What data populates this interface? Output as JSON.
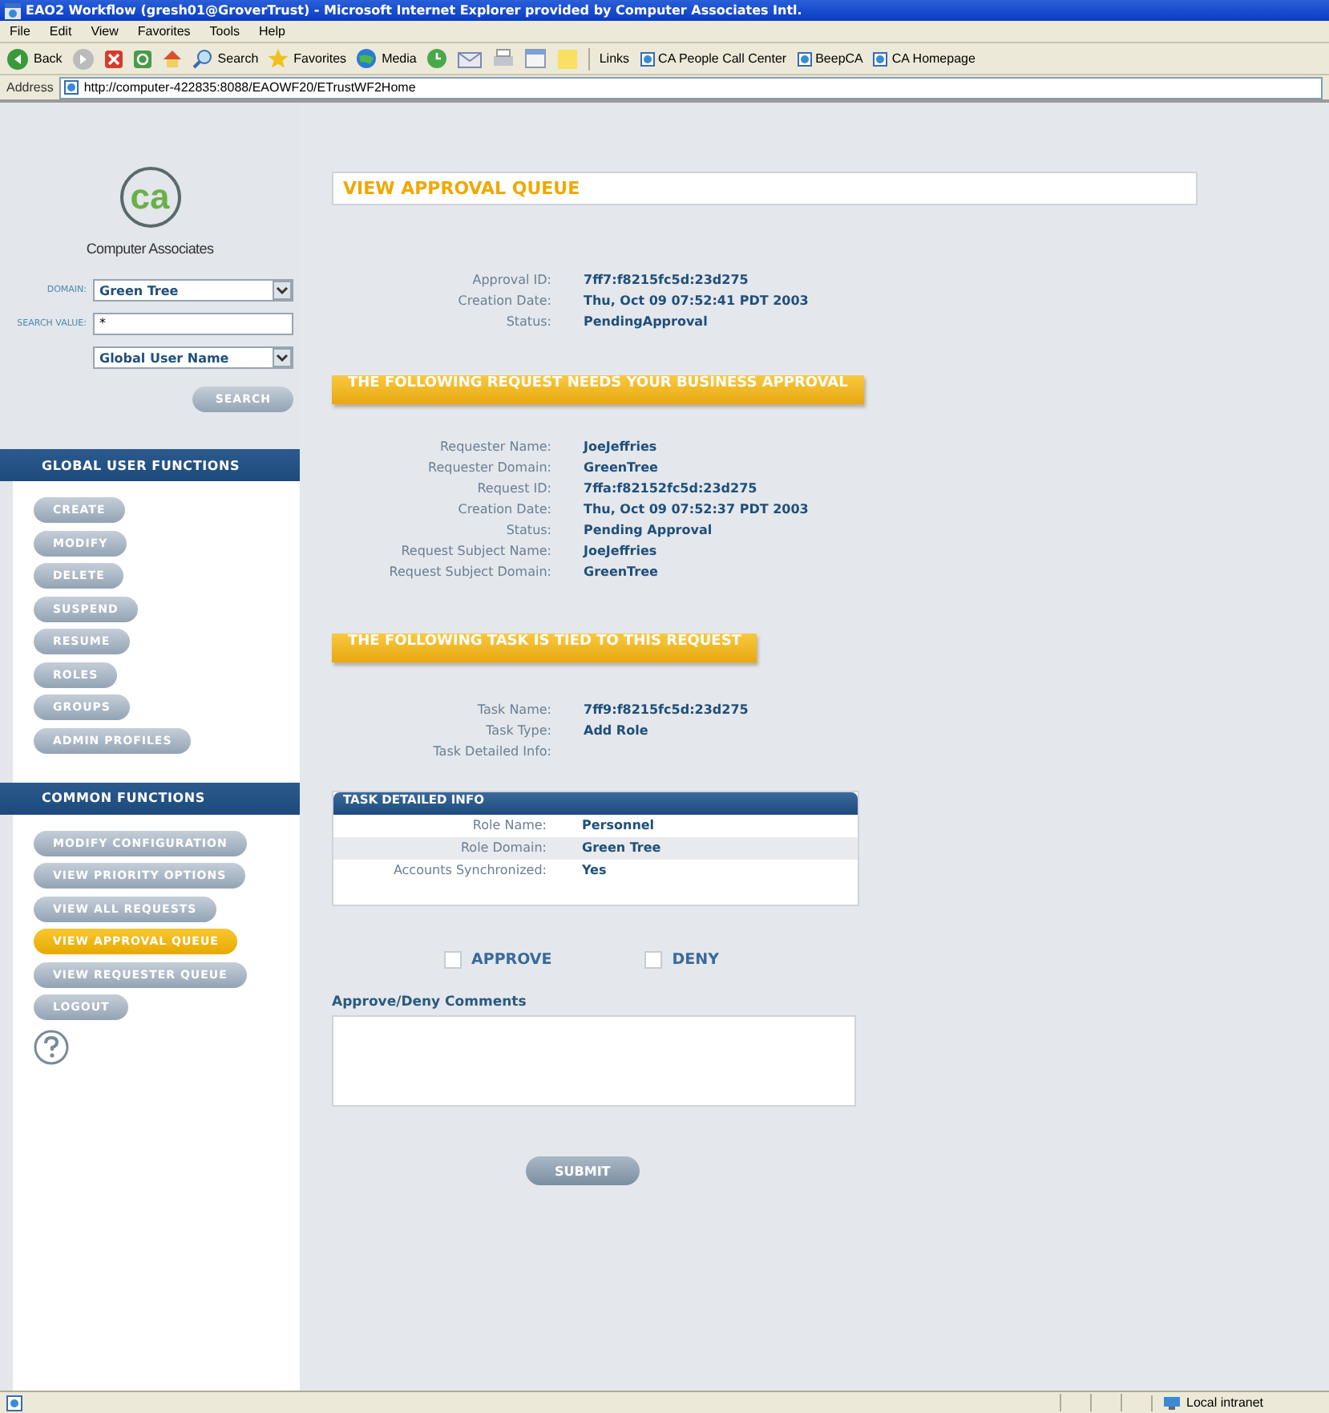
{
  "window": {
    "title": "EAO2 Workflow (gresh01@GroverTrust) - Microsoft Internet Explorer provided by Computer Associates Intl."
  },
  "menu": [
    "File",
    "Edit",
    "View",
    "Favorites",
    "Tools",
    "Help"
  ],
  "toolbar": {
    "back": "Back",
    "search": "Search",
    "favorites": "Favorites",
    "media": "Media"
  },
  "links": {
    "label": "Links",
    "items": [
      "CA People Call Center",
      "BeepCA",
      "CA Homepage"
    ]
  },
  "address": {
    "label": "Address",
    "value": "http://computer-422835:8088/EAOWF20/ETrustWF2Home"
  },
  "sidebar": {
    "logo": "ca",
    "company": "Computer Associates",
    "search": {
      "domain_label": "DOMAIN:",
      "domain": "Green Tree",
      "value_label": "SEARCH VALUE:",
      "value": "*",
      "attribute": "Global User Name",
      "button": "SEARCH"
    },
    "sections": [
      {
        "title": "GLOBAL USER FUNCTIONS",
        "items": [
          {
            "label": "CREATE",
            "selected": false
          },
          {
            "label": "MODIFY",
            "selected": false
          },
          {
            "label": "DELETE",
            "selected": false
          },
          {
            "label": "SUSPEND",
            "selected": false
          },
          {
            "label": "RESUME",
            "selected": false
          },
          {
            "label": "ROLES",
            "selected": false
          },
          {
            "label": "GROUPS",
            "selected": false
          },
          {
            "label": "ADMIN PROFILES",
            "selected": false
          }
        ]
      },
      {
        "title": "COMMON FUNCTIONS",
        "items": [
          {
            "label": "MODIFY CONFIGURATION",
            "selected": false
          },
          {
            "label": "VIEW PRIORITY OPTIONS",
            "selected": false
          },
          {
            "label": "VIEW ALL REQUESTS",
            "selected": false
          },
          {
            "label": "VIEW APPROVAL QUEUE",
            "selected": true
          },
          {
            "label": "VIEW REQUESTER QUEUE",
            "selected": false
          },
          {
            "label": "LOGOUT",
            "selected": false
          }
        ]
      }
    ]
  },
  "main": {
    "title": "VIEW APPROVAL QUEUE",
    "approval": [
      {
        "label": "Approval ID:",
        "value": "7ff7:f8215fc5d:23d275"
      },
      {
        "label": "Creation Date:",
        "value": "Thu, Oct 09 07:52:41 PDT 2003"
      },
      {
        "label": "Status:",
        "value": "PendingApproval"
      }
    ],
    "request_banner": "THE FOLLOWING REQUEST NEEDS YOUR BUSINESS APPROVAL",
    "request": [
      {
        "label": "Requester Name:",
        "value": "JoeJeffries"
      },
      {
        "label": "Requester Domain:",
        "value": "GreenTree"
      },
      {
        "label": "Request ID:",
        "value": "7ffa:f82152fc5d:23d275"
      },
      {
        "label": "Creation Date:",
        "value": "Thu, Oct 09 07:52:37 PDT 2003"
      },
      {
        "label": "Status:",
        "value": "Pending Approval"
      },
      {
        "label": "Request Subject Name:",
        "value": "JoeJeffries"
      },
      {
        "label": "Request Subject Domain:",
        "value": "GreenTree"
      }
    ],
    "task_banner": "THE FOLLOWING TASK IS TIED TO THIS REQUEST",
    "task": [
      {
        "label": "Task Name:",
        "value": "7ff9:f8215fc5d:23d275"
      },
      {
        "label": "Task Type:",
        "value": "Add Role"
      },
      {
        "label": "Task Detailed Info:"
      }
    ],
    "task_table": {
      "title": "TASK DETAILED INFO",
      "rows": [
        {
          "label": "Role Name:",
          "value": "Personnel"
        },
        {
          "label": "Role Domain:",
          "value": "Green Tree"
        },
        {
          "label": "Accounts Synchronized:",
          "value": "Yes"
        }
      ]
    },
    "decisions": [
      {
        "label": "APPROVE",
        "checked": false
      },
      {
        "label": "DENY",
        "checked": false
      }
    ],
    "comments_label": "Approve/Deny Comments",
    "submit": "SUBMIT"
  },
  "status_bar": {
    "zone": "Local intranet"
  }
}
